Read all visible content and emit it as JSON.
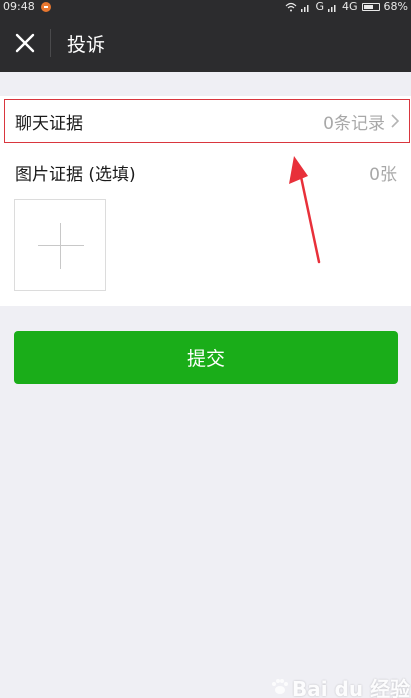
{
  "status_bar": {
    "time": "09:48",
    "signal": "G",
    "network": "4G",
    "battery_level": 0.68,
    "battery_text": "68%",
    "notification_color": "#e9772f"
  },
  "nav": {
    "close_icon": "close-icon",
    "title": "投诉"
  },
  "chat_evidence": {
    "label": "聊天证据",
    "value": "0条记录",
    "chevron_icon": "chevron-right-icon",
    "highlight_color": "#d9363e"
  },
  "image_evidence": {
    "label": "图片证据 (选填)",
    "count": "0张",
    "add_icon": "plus-icon"
  },
  "submit": {
    "label": "提交",
    "color": "#1aad19"
  },
  "annotation": {
    "arrow_color": "#e8303a"
  },
  "watermark": {
    "text": "Bai du 经验",
    "icon": "paw-icon"
  }
}
